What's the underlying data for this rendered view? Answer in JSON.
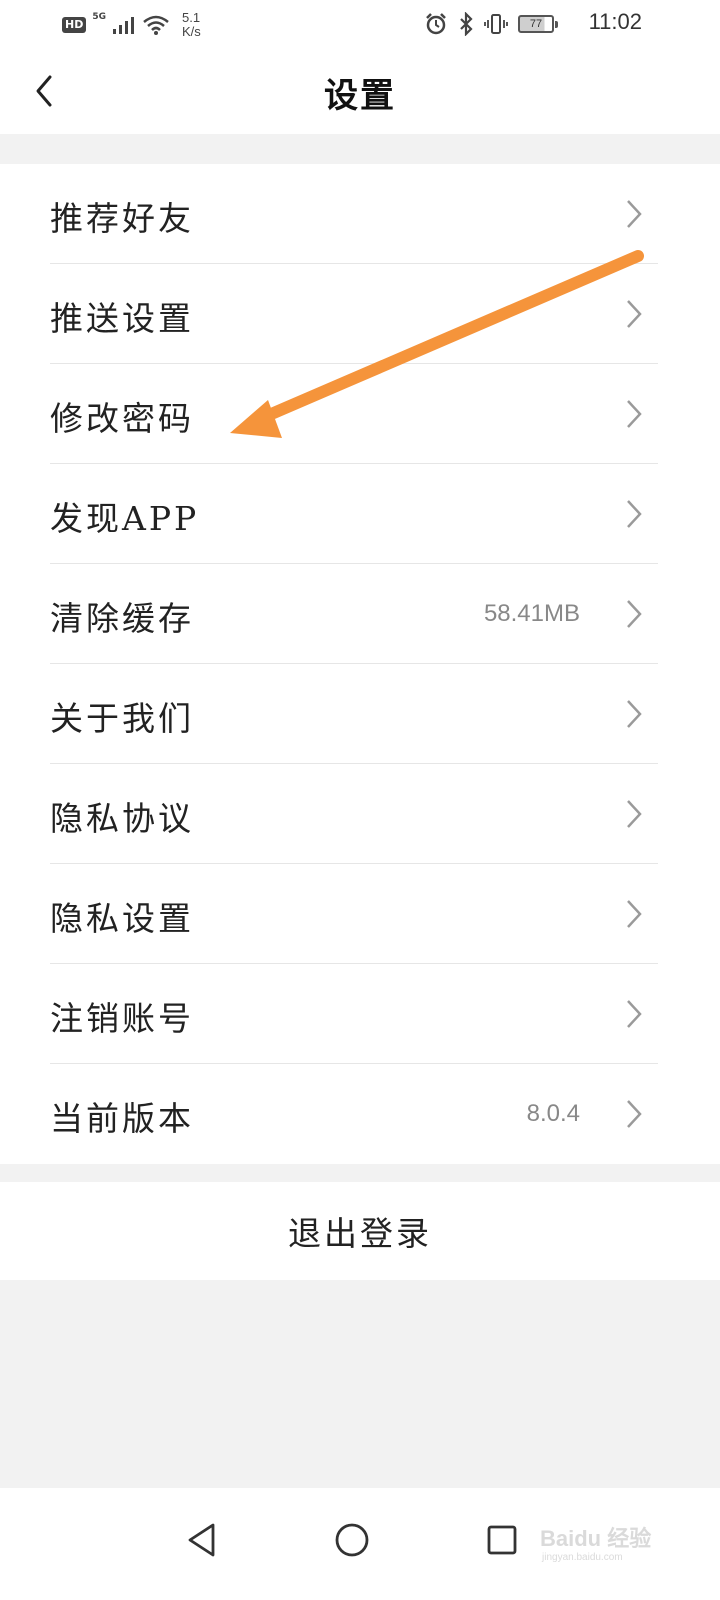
{
  "status_bar": {
    "hd": "HD",
    "network": "5G",
    "speed_value": "5.1",
    "speed_unit": "K/s",
    "battery": "77",
    "time": "11:02"
  },
  "header": {
    "title": "设置",
    "back_icon": "chevron-left-icon"
  },
  "settings": {
    "items": [
      {
        "label": "推荐好友",
        "value": ""
      },
      {
        "label": "推送设置",
        "value": ""
      },
      {
        "label": "修改密码",
        "value": ""
      },
      {
        "label": "发现APP",
        "value": ""
      },
      {
        "label": "清除缓存",
        "value": "58.41MB"
      },
      {
        "label": "关于我们",
        "value": ""
      },
      {
        "label": "隐私协议",
        "value": ""
      },
      {
        "label": "隐私设置",
        "value": ""
      },
      {
        "label": "注销账号",
        "value": ""
      },
      {
        "label": "当前版本",
        "value": "8.0.4"
      }
    ]
  },
  "logout": {
    "label": "退出登录"
  },
  "annotation": {
    "color": "#f5943b",
    "points_to": "修改密码"
  },
  "nav_bar": {
    "icons": [
      "back-triangle-icon",
      "home-circle-icon",
      "recents-square-icon"
    ]
  },
  "watermark": {
    "text": "Baidu 经验",
    "sub": "jingyan.baidu.com"
  },
  "colors": {
    "background": "#f2f2f2",
    "surface": "#ffffff",
    "divider": "#e6e6e6",
    "secondary_text": "#888888"
  }
}
